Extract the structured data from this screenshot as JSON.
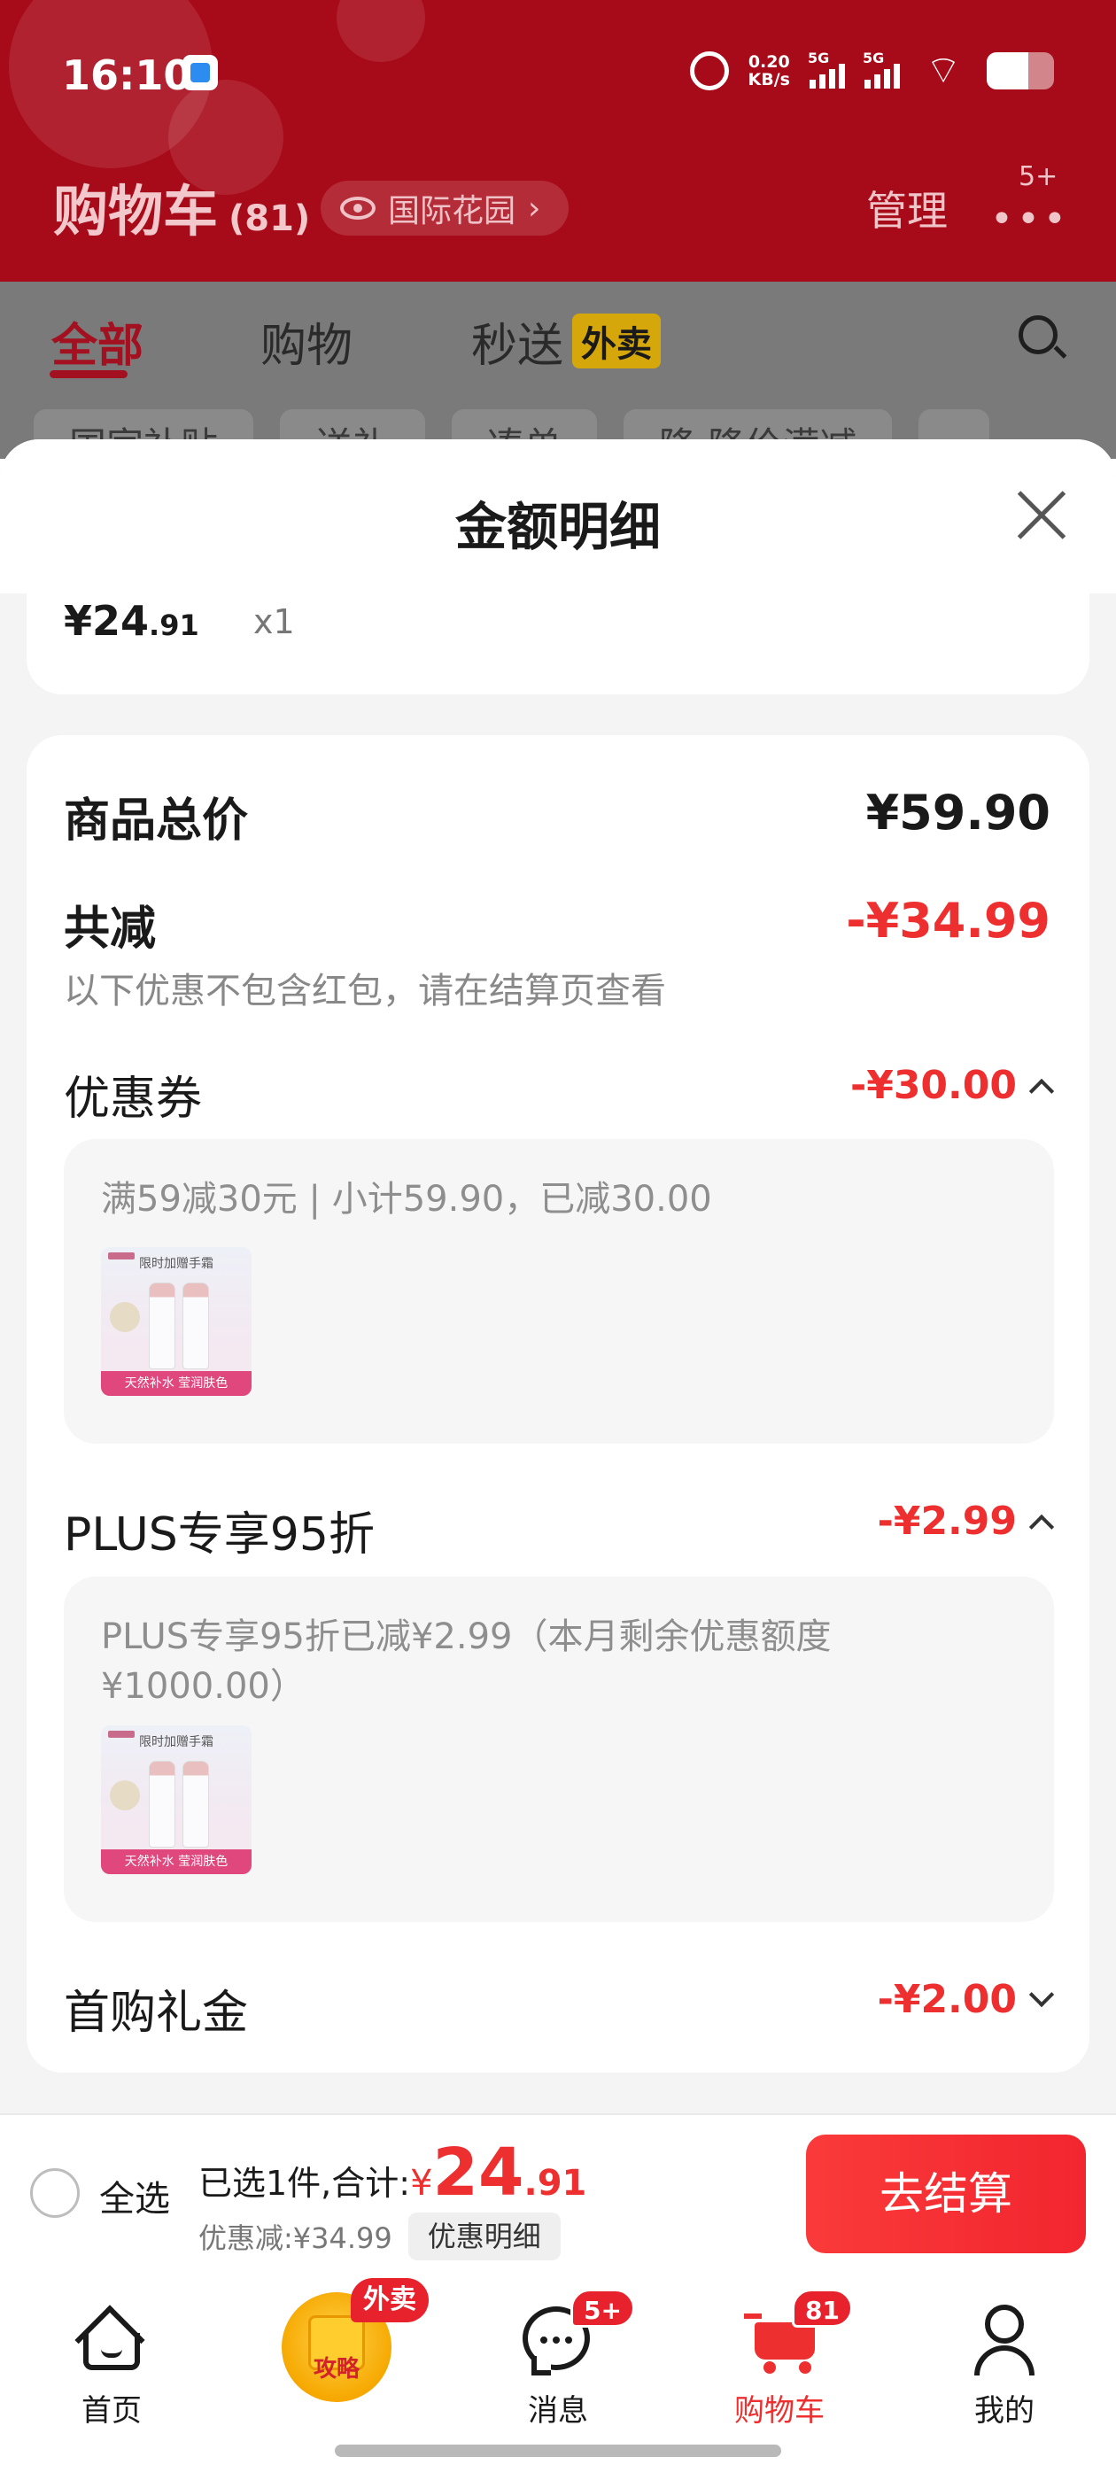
{
  "status_bar": {
    "time": "16:10",
    "net_speed_value": "0.20",
    "net_speed_unit": "KB/s",
    "signal1_label": "5G",
    "signal2_label": "5G"
  },
  "header": {
    "title": "购物车",
    "count": "(81)",
    "location": "国际花园",
    "location_chevron": "›",
    "manage": "管理",
    "more_icon": "•••",
    "more_badge": "5+"
  },
  "tabs": [
    {
      "label": "全部"
    },
    {
      "label": "购物"
    },
    {
      "label": "秒送"
    }
  ],
  "tab_tag": "外卖",
  "chips": [
    "国家补贴",
    "送礼",
    "凑单",
    "降 降价满减",
    ""
  ],
  "sheet": {
    "title": "金额明细",
    "item": {
      "price_int": "¥24",
      "price_dec": ".91",
      "qty": "x1"
    },
    "total_label": "商品总价",
    "total_value": "¥59.90",
    "reduce_label": "共减",
    "reduce_value": "-¥34.99",
    "reduce_note": "以下优惠不包含红包，请在结算页查看",
    "coupon": {
      "label": "优惠券",
      "value": "-¥30.00",
      "detail": "满59减30元 | 小计59.90，已减30.00",
      "thumb": {
        "header": "限时加赠手霜",
        "footer": "天然补水 莹润肤色"
      }
    },
    "plus": {
      "label": "PLUS专享95折",
      "value": "-¥2.99",
      "detail": "PLUS专享95折已减¥2.99（本月剩余优惠额度¥1000.00）",
      "thumb": {
        "header": "限时加赠手霜",
        "footer": "天然补水 莹润肤色"
      }
    },
    "first_gift": {
      "label": "首购礼金",
      "value": "-¥2.00"
    }
  },
  "checkout": {
    "select_all": "全选",
    "selected_prefix": "已选1件,合计:",
    "total_yen": "¥",
    "total_int": "24",
    "total_dec": ".91",
    "discount_text": "优惠减:¥34.99",
    "detail_button": "优惠明细",
    "submit": "去结算"
  },
  "bottom_nav": [
    {
      "label": "首页"
    },
    {
      "label": "攻略",
      "badge": "外卖"
    },
    {
      "label": "消息",
      "badge": "5+"
    },
    {
      "label": "购物车",
      "badge": "81"
    },
    {
      "label": "我的"
    }
  ],
  "colors": {
    "header_red": "#a70a18",
    "price_red": "#ee2f2f",
    "checkout_btn": "#f2262f"
  }
}
